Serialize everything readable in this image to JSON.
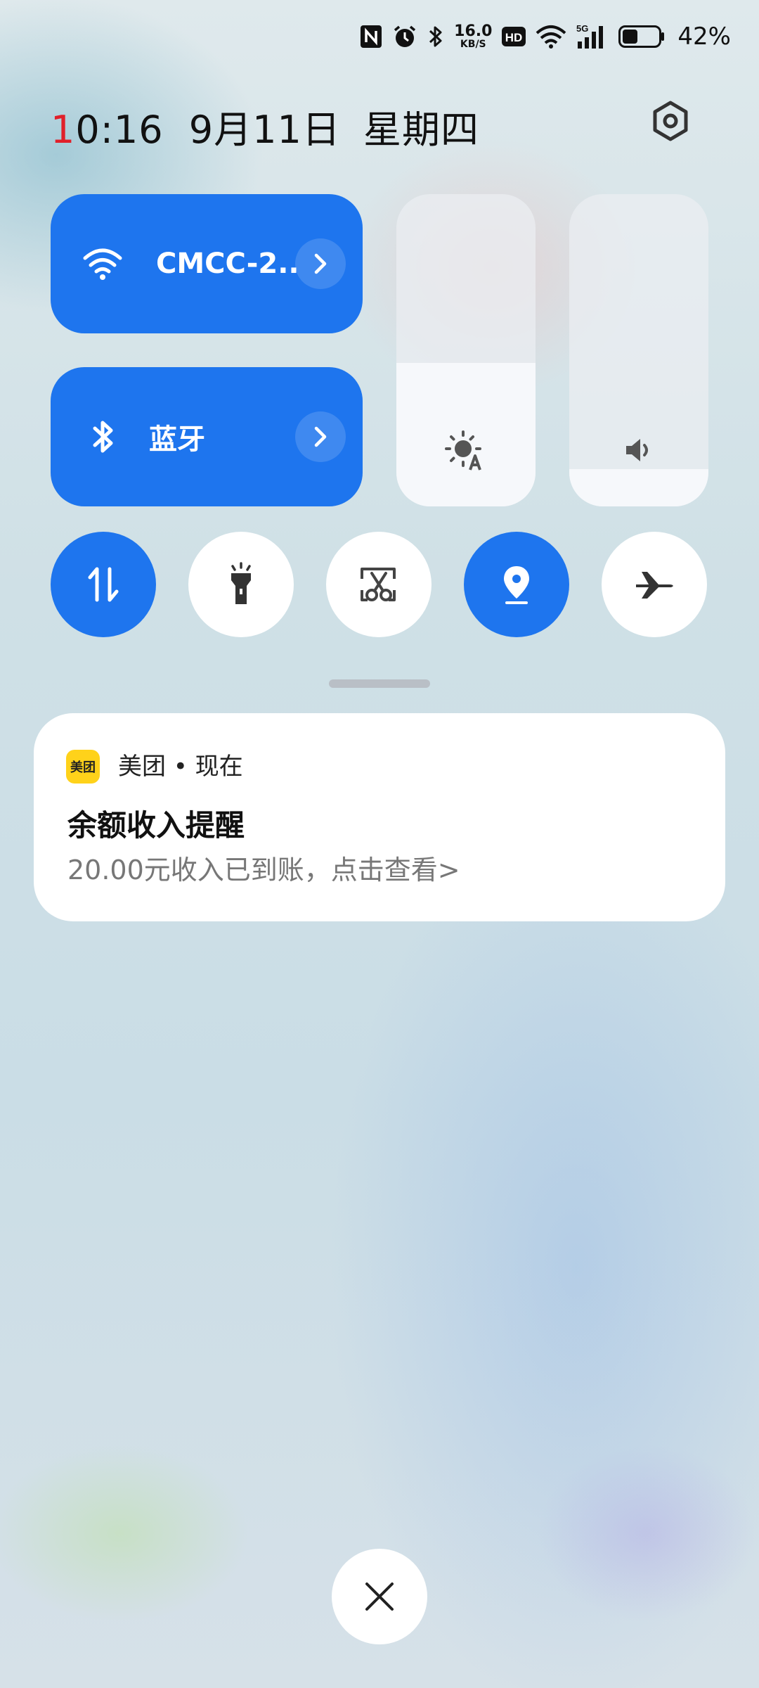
{
  "status_bar": {
    "net_speed_value": "16.0",
    "net_speed_unit": "KB/S",
    "hd": "HD",
    "network": "5G",
    "battery_pct": "42%",
    "battery_level": 0.42,
    "icons": [
      "nfc-icon",
      "alarm-icon",
      "bluetooth-icon",
      "hd-icon",
      "wifi-icon",
      "cellular-signal-icon",
      "battery-icon"
    ]
  },
  "header": {
    "time_first_digit": "1",
    "time_rest": "0:16",
    "date": "9月11日",
    "weekday": "星期四",
    "settings_icon": "gear-icon"
  },
  "tiles": {
    "wifi": {
      "label": "CMCC-2..",
      "icon": "wifi-icon"
    },
    "bluetooth": {
      "label": "蓝牙",
      "icon": "bluetooth-icon"
    }
  },
  "sliders": {
    "brightness_level": 0.46,
    "volume_level": 0.12
  },
  "toggles": [
    {
      "name": "mobile-data",
      "icon": "data-transfer-icon",
      "on": true
    },
    {
      "name": "flashlight",
      "icon": "flashlight-icon",
      "on": false
    },
    {
      "name": "screenshot",
      "icon": "screenshot-scissors-icon",
      "on": false
    },
    {
      "name": "location",
      "icon": "location-pin-icon",
      "on": true
    },
    {
      "name": "airplane-mode",
      "icon": "airplane-icon",
      "on": false
    }
  ],
  "notification": {
    "app_icon_text": "美团",
    "app_line": "美团 • 现在",
    "title": "余额收入提醒",
    "body": "20.00元收入已到账，点击查看>"
  },
  "colors": {
    "accent": "#1e75ee",
    "time_highlight": "#e0202a",
    "app_icon_bg": "#ffd21a"
  }
}
